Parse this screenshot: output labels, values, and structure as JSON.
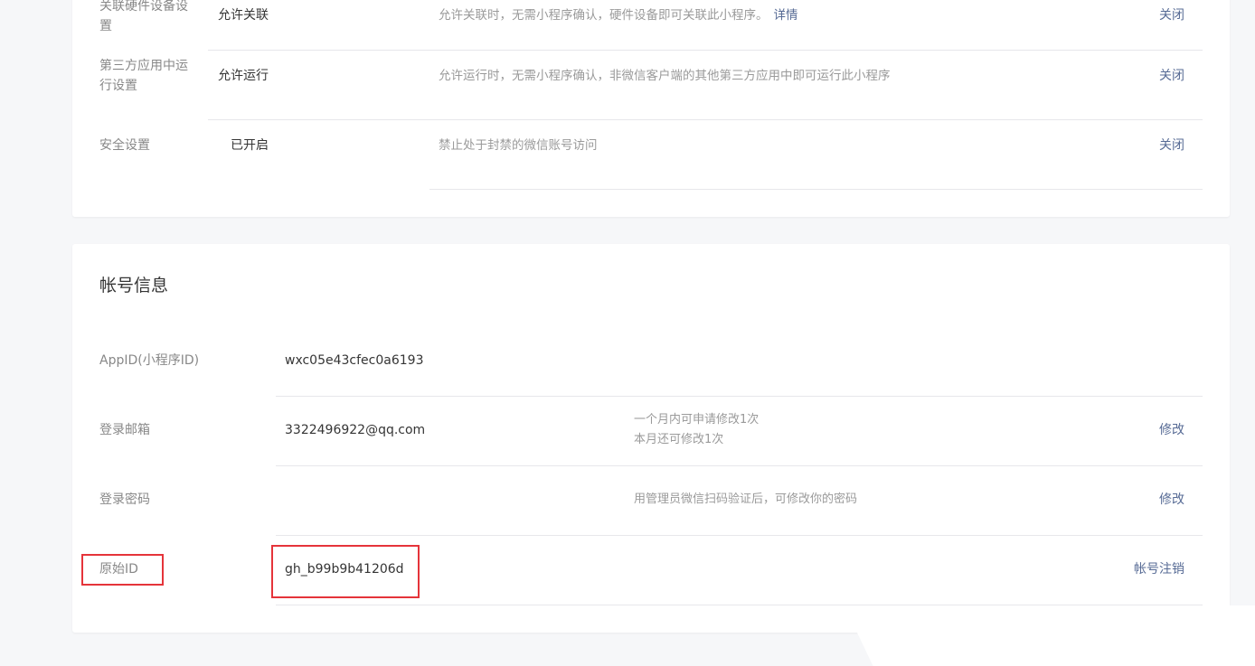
{
  "settings": {
    "rows": [
      {
        "label": "关联硬件设备设置",
        "value": "允许关联",
        "desc": "允许关联时，无需小程序确认，硬件设备即可关联此小程序。",
        "link": "详情",
        "action": "关闭"
      },
      {
        "label": "第三方应用中运行设置",
        "value": "允许运行",
        "desc": "允许运行时，无需小程序确认，非微信客户端的其他第三方应用中即可运行此小程序",
        "action": "关闭"
      },
      {
        "label": "安全设置",
        "value": "已开启",
        "desc": "禁止处于封禁的微信账号访问",
        "action": "关闭"
      }
    ]
  },
  "account": {
    "title": "帐号信息",
    "appid": {
      "label": "AppID(小程序ID)",
      "value": "wxc05e43cfec0a6193"
    },
    "email": {
      "label": "登录邮箱",
      "value": "3322496922@qq.com",
      "desc_line1": "一个月内可申请修改1次",
      "desc_line2": "本月还可修改1次",
      "action": "修改"
    },
    "password": {
      "label": "登录密码",
      "desc": "用管理员微信扫码验证后，可修改你的密码",
      "action": "修改"
    },
    "original_id": {
      "label": "原始ID",
      "value": "gh_b99b9b41206d",
      "action": "帐号注销"
    }
  },
  "colors": {
    "link": "#576b95",
    "highlight": "#e5343a"
  }
}
